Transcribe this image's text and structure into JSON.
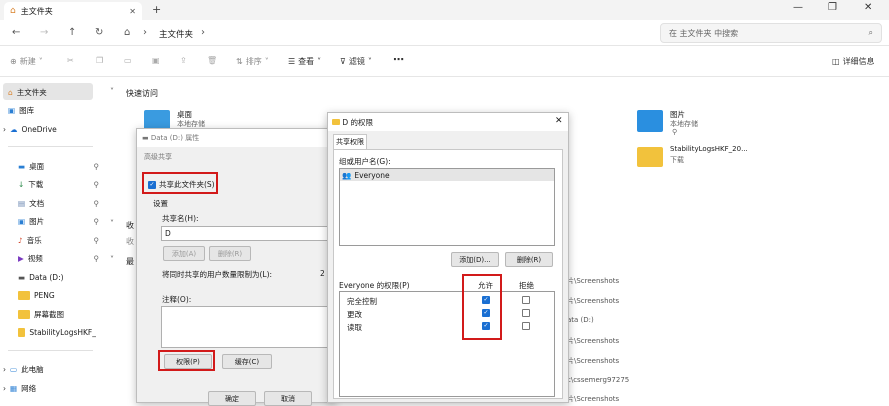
{
  "window": {
    "tab_title": "主文件夹",
    "new_tab": "+"
  },
  "nav": {
    "crumb1": "主文件夹",
    "search_placeholder": "在 主文件夹 中搜索"
  },
  "toolbar": {
    "new": "新建",
    "sort": "排序",
    "view": "查看",
    "filter": "滤镜",
    "details": "详细信息"
  },
  "sidebar": {
    "items": [
      {
        "label": "主文件夹"
      },
      {
        "label": "图库"
      },
      {
        "label": "OneDrive"
      },
      {
        "label": "桌面"
      },
      {
        "label": "下载"
      },
      {
        "label": "文档"
      },
      {
        "label": "图片"
      },
      {
        "label": "音乐"
      },
      {
        "label": "视频"
      },
      {
        "label": "Data (D:)"
      },
      {
        "label": "PENG"
      },
      {
        "label": "屏幕截图"
      },
      {
        "label": "StabilityLogsHKF_"
      },
      {
        "label": "此电脑"
      },
      {
        "label": "网络"
      }
    ]
  },
  "main": {
    "quick_access": "快速访问",
    "group2": "收",
    "group3": "最",
    "tiles": [
      {
        "name": "桌面",
        "sub": "本地存储"
      },
      {
        "name": "图片",
        "sub": "本地存储"
      },
      {
        "name": "StabilityLogsHKF_20...",
        "sub": "下载"
      }
    ],
    "recent_paths": [
      "片\\Screenshots",
      "片\\Screenshots",
      "ata (D:)",
      "片\\Screenshots",
      "片\\Screenshots",
      "c\\cssemerg97275",
      "片\\Screenshots"
    ],
    "partial_text": "收"
  },
  "props_dialog": {
    "title": "Data (D:) 属性",
    "tab": "高级共享",
    "share_check": "共享此文件夹(S)",
    "settings": "设置",
    "share_name_label": "共享名(H):",
    "share_name_value": "D",
    "add": "添加(A)",
    "remove": "删除(R)",
    "limit_label": "将同时共享的用户数量限制为(L):",
    "limit_value": "2",
    "comment_label": "注释(O):",
    "permissions": "权限(P)",
    "cache": "缓存(C)",
    "ok": "确定",
    "cancel": "取消"
  },
  "perm_dialog": {
    "title": "D 的权限",
    "tab": "共享权限",
    "group_label": "组或用户名(G):",
    "user": "Everyone",
    "add": "添加(D)...",
    "remove": "删除(R)",
    "perm_label": "Everyone 的权限(P)",
    "allow": "允许",
    "deny": "拒绝",
    "rows": [
      {
        "name": "完全控制",
        "allow": true,
        "deny": false
      },
      {
        "name": "更改",
        "allow": true,
        "deny": false
      },
      {
        "name": "读取",
        "allow": true,
        "deny": false
      }
    ]
  },
  "colors": {
    "accent": "#1a6fd2",
    "highlight": "#d21a1a"
  }
}
